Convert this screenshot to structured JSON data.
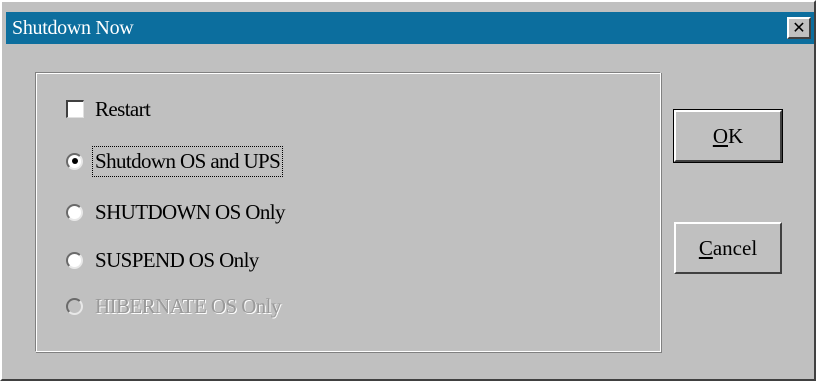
{
  "window": {
    "title": "Shutdown Now",
    "close_glyph": "✕"
  },
  "options": {
    "restart": {
      "label": "Restart",
      "checked": false
    },
    "shutdown_os_and_ups": {
      "label": "Shutdown OS and UPS",
      "selected": true
    },
    "shutdown_os_only": {
      "label": "SHUTDOWN OS Only",
      "selected": false
    },
    "suspend_os_only": {
      "label": "SUSPEND OS Only",
      "selected": false
    },
    "hibernate_os_only": {
      "label": "HIBERNATE OS Only",
      "selected": false,
      "disabled": true
    }
  },
  "buttons": {
    "ok": {
      "mnemonic": "O",
      "rest": "K"
    },
    "cancel": {
      "mnemonic": "C",
      "rest": "ancel"
    }
  },
  "colors": {
    "titlebar": "#0c6e9e",
    "face": "#c0c0c0",
    "disabled_text": "#9a9a9a"
  },
  "icons": {
    "close": "close-icon",
    "radio": "radio-icon",
    "checkbox": "checkbox-icon"
  }
}
